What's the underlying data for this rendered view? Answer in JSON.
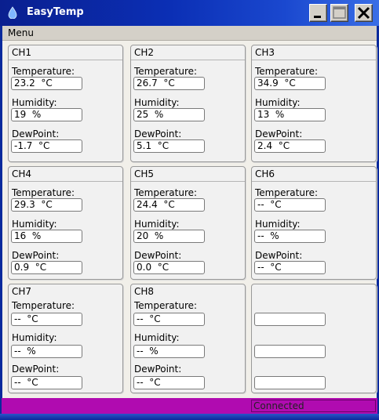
{
  "window": {
    "title": "EasyTemp"
  },
  "menu": {
    "label": "Menu"
  },
  "labels": {
    "temperature": "Temperature:",
    "humidity": "Humidity:",
    "dewpoint": "DewPoint:"
  },
  "channels": [
    {
      "name": "CH1",
      "temperature": "23.2  °C",
      "humidity": "19  %",
      "dewpoint": "-1.7  °C"
    },
    {
      "name": "CH2",
      "temperature": "26.7  °C",
      "humidity": "25  %",
      "dewpoint": "5.1  °C"
    },
    {
      "name": "CH3",
      "temperature": "34.9  °C",
      "humidity": "13  %",
      "dewpoint": "2.4  °C"
    },
    {
      "name": "CH4",
      "temperature": "29.3  °C",
      "humidity": "16  %",
      "dewpoint": "0.9  °C"
    },
    {
      "name": "CH5",
      "temperature": "24.4  °C",
      "humidity": "20  %",
      "dewpoint": "0.0  °C"
    },
    {
      "name": "CH6",
      "temperature": "--  °C",
      "humidity": "--  %",
      "dewpoint": "--  °C"
    },
    {
      "name": "CH7",
      "temperature": "--  °C",
      "humidity": "--  %",
      "dewpoint": "--  °C"
    },
    {
      "name": "CH8",
      "temperature": "--  °C",
      "humidity": "--  %",
      "dewpoint": "--  °C"
    },
    {
      "name": "",
      "temperature": "",
      "humidity": "",
      "dewpoint": ""
    }
  ],
  "status": {
    "text": "Connected"
  },
  "colors": {
    "titlebar": "#0b2fb5",
    "statusbar": "#b00bb0"
  }
}
